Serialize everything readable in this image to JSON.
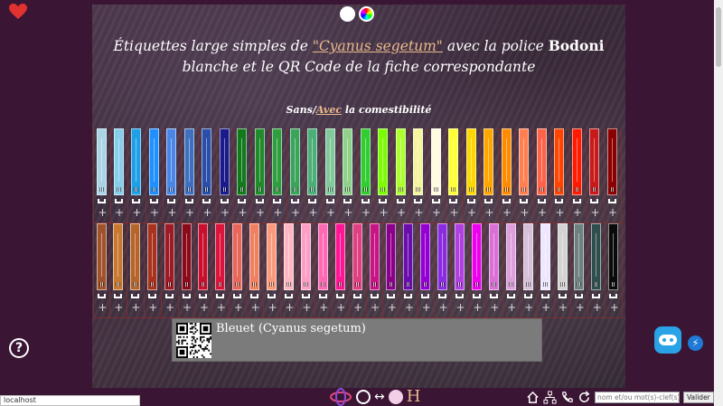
{
  "header": {
    "title_part1": "Étiquettes large simples de ",
    "title_link": "\"Cyanus segetum\"",
    "title_part2": " avec la police ",
    "title_font": "Bodoni",
    "title_part3": " blanche et le QR Code de la fiche correspondante"
  },
  "toggle": {
    "option_without": "Sans",
    "separator": "/",
    "option_with": "Avec",
    "suffix": " la comestibilité"
  },
  "swatches": {
    "row1": [
      "#a8d4e6",
      "#87ceeb",
      "#1e9fe6",
      "#1e90ff",
      "#4a86e8",
      "#3f6fbf",
      "#2a4fa8",
      "#1a1a8c",
      "#137a1c",
      "#1f8b2a",
      "#2e9e3e",
      "#3aa55a",
      "#4caf78",
      "#7fc99a",
      "#8fd08a",
      "#32cd32",
      "#7cfc00",
      "#adff2f",
      "#f5f5a0",
      "#fffae0",
      "#ffff33",
      "#ffd700",
      "#ffa500",
      "#ff8c00",
      "#ff7f50",
      "#ff6347",
      "#ff4500",
      "#ff1a00",
      "#c81a1a",
      "#8b0000"
    ],
    "row2": [
      "#a0522d",
      "#c8782f",
      "#b5652a",
      "#a8321e",
      "#9e1a24",
      "#8b0a1a",
      "#c8102e",
      "#dc143c",
      "#e8675a",
      "#f08060",
      "#fa9a7a",
      "#ffb6c1",
      "#ff9ec4",
      "#ff69b4",
      "#ff1493",
      "#e0407f",
      "#c71585",
      "#8b008b",
      "#6a0dad",
      "#9400d3",
      "#8a2be2",
      "#b040e0",
      "#ee00ee",
      "#da70d6",
      "#dda0dd",
      "#d8bfd8",
      "#f0e6ff",
      "#d3d3d3",
      "#6e8080",
      "#2f4f4f",
      "#0a0a0a"
    ]
  },
  "plus_symbol": "+",
  "selected": {
    "label": "Bleuet (Cyanus segetum)"
  },
  "status_url": "localhost",
  "search": {
    "placeholder": "nom et/ou mot(s)-clef(s)",
    "submit_label": "Valider"
  },
  "nav": {
    "letter_h": "H",
    "arrows": "↔"
  },
  "help_glyph": "?",
  "bolt_glyph": "⚡",
  "colors": {
    "background": "#3a1534",
    "accent": "#e9b98a",
    "grid_line": "#7a2e33",
    "bot_blue": "#2aa2e6"
  }
}
